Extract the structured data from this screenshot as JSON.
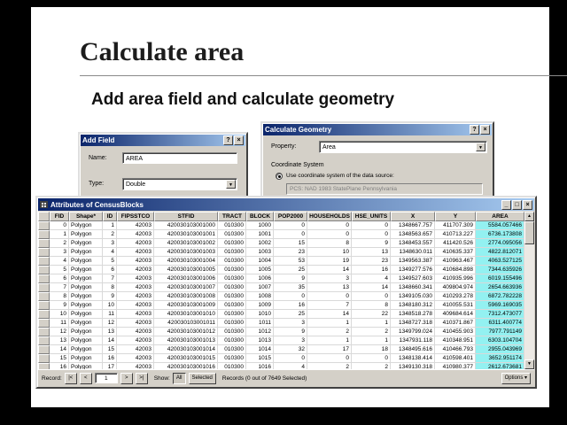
{
  "slide": {
    "title": "Calculate area",
    "subtitle": "Add area field and calculate geometry"
  },
  "icons": {
    "help": "?",
    "close": "×",
    "minimize": "_",
    "maximize": "□",
    "dropdown": "▼",
    "scroll_up": "▲",
    "scroll_down": "▼"
  },
  "add_field_dialog": {
    "title": "Add Field",
    "name_label": "Name:",
    "name_value": "AREA",
    "type_label": "Type:",
    "type_value": "Double"
  },
  "calc_geometry_dialog": {
    "title": "Calculate Geometry",
    "property_label": "Property:",
    "property_value": "Area",
    "coordinate_system_label": "Coordinate System",
    "radio_source_label": "Use coordinate system of the data source:",
    "source_cs_value": "PCS: NAD 1983 StatePlane Pennsylvania"
  },
  "table_window": {
    "title": "Attributes of CensusBlocks",
    "columns": [
      "FID",
      "Shape*",
      "ID",
      "FIPSSTCO",
      "STFID",
      "TRACT",
      "BLOCK",
      "POP2000",
      "HOUSEHOLDS",
      "HSE_UNITS",
      "X",
      "Y",
      "AREA"
    ],
    "rows": [
      [
        "0",
        "Polygon",
        "1",
        "42003",
        "420030103001000",
        "010300",
        "1000",
        "0",
        "0",
        "0",
        "1348667.757",
        "411707.309",
        "5584.057466"
      ],
      [
        "1",
        "Polygon",
        "2",
        "42003",
        "420030103001001",
        "010300",
        "1001",
        "0",
        "0",
        "0",
        "1348563.657",
        "410713.227",
        "6736.173808"
      ],
      [
        "2",
        "Polygon",
        "3",
        "42003",
        "420030103001002",
        "010300",
        "1002",
        "15",
        "8",
        "9",
        "1348453.557",
        "411420.526",
        "2774.095056"
      ],
      [
        "3",
        "Polygon",
        "4",
        "42003",
        "420030103001003",
        "010300",
        "1003",
        "23",
        "10",
        "13",
        "1348630.011",
        "410635.337",
        "4822.812071"
      ],
      [
        "4",
        "Polygon",
        "5",
        "42003",
        "420030103001004",
        "010300",
        "1004",
        "53",
        "19",
        "23",
        "1349563.387",
        "410963.467",
        "4063.527125"
      ],
      [
        "5",
        "Polygon",
        "6",
        "42003",
        "420030103001005",
        "010300",
        "1005",
        "25",
        "14",
        "16",
        "1349277.576",
        "410684.898",
        "7344.635926"
      ],
      [
        "6",
        "Polygon",
        "7",
        "42003",
        "420030103001006",
        "010300",
        "1006",
        "9",
        "3",
        "4",
        "1349527.603",
        "410935.996",
        "6019.155496"
      ],
      [
        "7",
        "Polygon",
        "8",
        "42003",
        "420030103001007",
        "010300",
        "1007",
        "35",
        "13",
        "14",
        "1348660.341",
        "409804.974",
        "2654.663936"
      ],
      [
        "8",
        "Polygon",
        "9",
        "42003",
        "420030103001008",
        "010300",
        "1008",
        "0",
        "0",
        "0",
        "1349105.030",
        "410293.278",
        "6872.782228"
      ],
      [
        "9",
        "Polygon",
        "10",
        "42003",
        "420030103001009",
        "010300",
        "1009",
        "16",
        "7",
        "8",
        "1348180.312",
        "410055.531",
        "5969.169035"
      ],
      [
        "10",
        "Polygon",
        "11",
        "42003",
        "420030103001010",
        "010300",
        "1010",
        "25",
        "14",
        "22",
        "1348518.278",
        "409684.614",
        "7312.473077"
      ],
      [
        "11",
        "Polygon",
        "12",
        "42003",
        "420030103001011",
        "010300",
        "1011",
        "3",
        "1",
        "1",
        "1348727.318",
        "410371.867",
        "6311.400774"
      ],
      [
        "12",
        "Polygon",
        "13",
        "42003",
        "420030103001012",
        "010300",
        "1012",
        "9",
        "2",
        "2",
        "1349799.024",
        "410455.903",
        "7977.791149"
      ],
      [
        "13",
        "Polygon",
        "14",
        "42003",
        "420030103001013",
        "010300",
        "1013",
        "3",
        "1",
        "1",
        "1347931.118",
        "410348.951",
        "6303.104704"
      ],
      [
        "14",
        "Polygon",
        "15",
        "42003",
        "420030103001014",
        "010300",
        "1014",
        "32",
        "17",
        "18",
        "1348495.616",
        "410466.793",
        "2955.043969"
      ],
      [
        "15",
        "Polygon",
        "16",
        "42003",
        "420030103001015",
        "010300",
        "1015",
        "0",
        "0",
        "0",
        "1348138.414",
        "410598.401",
        "3652.951174"
      ],
      [
        "16",
        "Polygon",
        "17",
        "42003",
        "420030103001016",
        "010300",
        "1016",
        "4",
        "2",
        "2",
        "1349130.318",
        "410980.377",
        "2612.673681"
      ]
    ],
    "nav": {
      "record_label": "Record:",
      "first": "|<",
      "prev": "<",
      "record_value": "1",
      "next": ">",
      "last": ">|",
      "show_label": "Show:",
      "all": "All",
      "selected": "Selected",
      "records_text": "Records (0 out of 7649 Selected)",
      "options": "Options ▾"
    }
  },
  "colors": {
    "titlebar_start": "#0a246a",
    "titlebar_end": "#a6caf0",
    "dialog_bg": "#d4d0c8",
    "selected_column_highlight": "#93f1f1",
    "slide_bg": "#ffffff",
    "frame_bg": "#000000"
  }
}
